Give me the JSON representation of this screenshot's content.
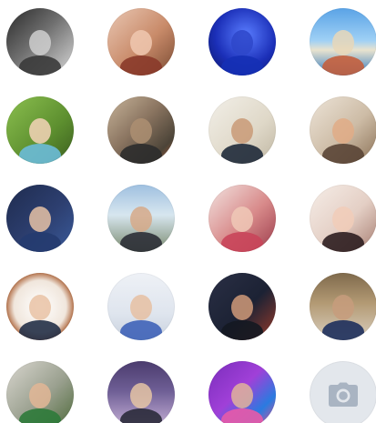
{
  "photos": [
    {
      "id": "photo-1",
      "bg": "linear-gradient(135deg,#2b2b2b 0%,#6e6e6e 45%,#d8d8d8 100%)",
      "skin": "#cfcfcf",
      "shirt": "#3a3a3a"
    },
    {
      "id": "photo-2",
      "bg": "linear-gradient(135deg,#e9c7b3 0%,#c98b6a 55%,#7a4b33 100%)",
      "skin": "#f0c8b0",
      "shirt": "#8a3a2a"
    },
    {
      "id": "photo-3",
      "bg": "radial-gradient(circle at 55% 40%,#5a7dff 0%,#1b2fb8 55%,#0b1560 100%)",
      "skin": "#2e46c9",
      "shirt": "#1530b5"
    },
    {
      "id": "photo-4",
      "bg": "linear-gradient(180deg,#5aa3e6 0%,#9fd0f5 48%,#e9e3cf 62%,#2f79c1 100%)",
      "skin": "#e8d7b8",
      "shirt": "#c45f3d"
    },
    {
      "id": "photo-5",
      "bg": "linear-gradient(135deg,#8bbf4f 0%,#5d8f2f 60%,#3b5e1f 100%)",
      "skin": "#f4d3b8",
      "shirt": "#6bbbd8"
    },
    {
      "id": "photo-6",
      "bg": "linear-gradient(135deg,#c7b49a 0%,#8a7460 45%,#4c4438 80%,#c0603a 100%)",
      "skin": "#ad8f72",
      "shirt": "#2c2c2c"
    },
    {
      "id": "photo-7",
      "bg": "linear-gradient(135deg,#f2efe8 0%,#dfd8c8 60%,#bfb6a2 100%)",
      "skin": "#c99a77",
      "shirt": "#1f2a3a"
    },
    {
      "id": "photo-8",
      "bg": "linear-gradient(135deg,#ede4d8 0%,#cdbca6 55%,#8c7257 100%)",
      "skin": "#e0ac86",
      "shirt": "#5a4536"
    },
    {
      "id": "photo-9",
      "bg": "linear-gradient(135deg,#1f2c4f 0%,#2d3f70 55%,#3a5a9a 100%)",
      "skin": "#e6c2a6",
      "shirt": "#253b6f"
    },
    {
      "id": "photo-10",
      "bg": "linear-gradient(180deg,#9fc0e0 0%,#d7e6ef 45%,#7a8a6e 100%)",
      "skin": "#d6a988",
      "shirt": "#2c2f36"
    },
    {
      "id": "photo-11",
      "bg": "linear-gradient(135deg,#f2e3e0 0%,#d88a8a 55%,#9b3b4b 100%)",
      "skin": "#f0c9b7",
      "shirt": "#c9455a"
    },
    {
      "id": "photo-12",
      "bg": "linear-gradient(135deg,#f6eee8 0%,#e4cfc5 55%,#a77e72 100%)",
      "skin": "#f1cdb8",
      "shirt": "#2e1e20"
    },
    {
      "id": "photo-13",
      "bg": "radial-gradient(circle at 50% 50%,#ffffff 0%,#f0e6dc 55%,#b87a55 70%,#8a4a2a 100%)",
      "skin": "#e9c2a5",
      "shirt": "#243047"
    },
    {
      "id": "photo-14",
      "bg": "linear-gradient(180deg,#eef1f6 0%,#dfe5ee 60%,#c9d2de 100%)",
      "skin": "#e6c0a2",
      "shirt": "#3f63b8"
    },
    {
      "id": "photo-15",
      "bg": "linear-gradient(135deg,#2a2f45 0%,#1c2234 55%,#9a3b2a 100%)",
      "skin": "#d09a79",
      "shirt": "#141821"
    },
    {
      "id": "photo-16",
      "bg": "linear-gradient(180deg,#7f6a4c 0%,#b39a74 45%,#d9cfbf 100%)",
      "skin": "#c79c7c",
      "shirt": "#1d2f5c"
    },
    {
      "id": "photo-17",
      "bg": "linear-gradient(135deg,#d9d6cf 0%,#9aa08f 55%,#4e6a3a 100%)",
      "skin": "#e2b695",
      "shirt": "#2d7a3a"
    },
    {
      "id": "photo-18",
      "bg": "linear-gradient(180deg,#4b3c6e 0%,#6f5f96 45%,#c9b3d8 100%)",
      "skin": "#e5c4a5",
      "shirt": "#2a2a3a"
    },
    {
      "id": "photo-19",
      "bg": "linear-gradient(135deg,#7a2dbb 0%,#a040d8 45%,#2a7be0 75%,#f04a8a 100%)",
      "skin": "#e1b49a",
      "shirt": "#e85aa8"
    }
  ],
  "camera_tile": {
    "bg": "#e3e7ec",
    "icon_color": "#a9b4c2"
  }
}
